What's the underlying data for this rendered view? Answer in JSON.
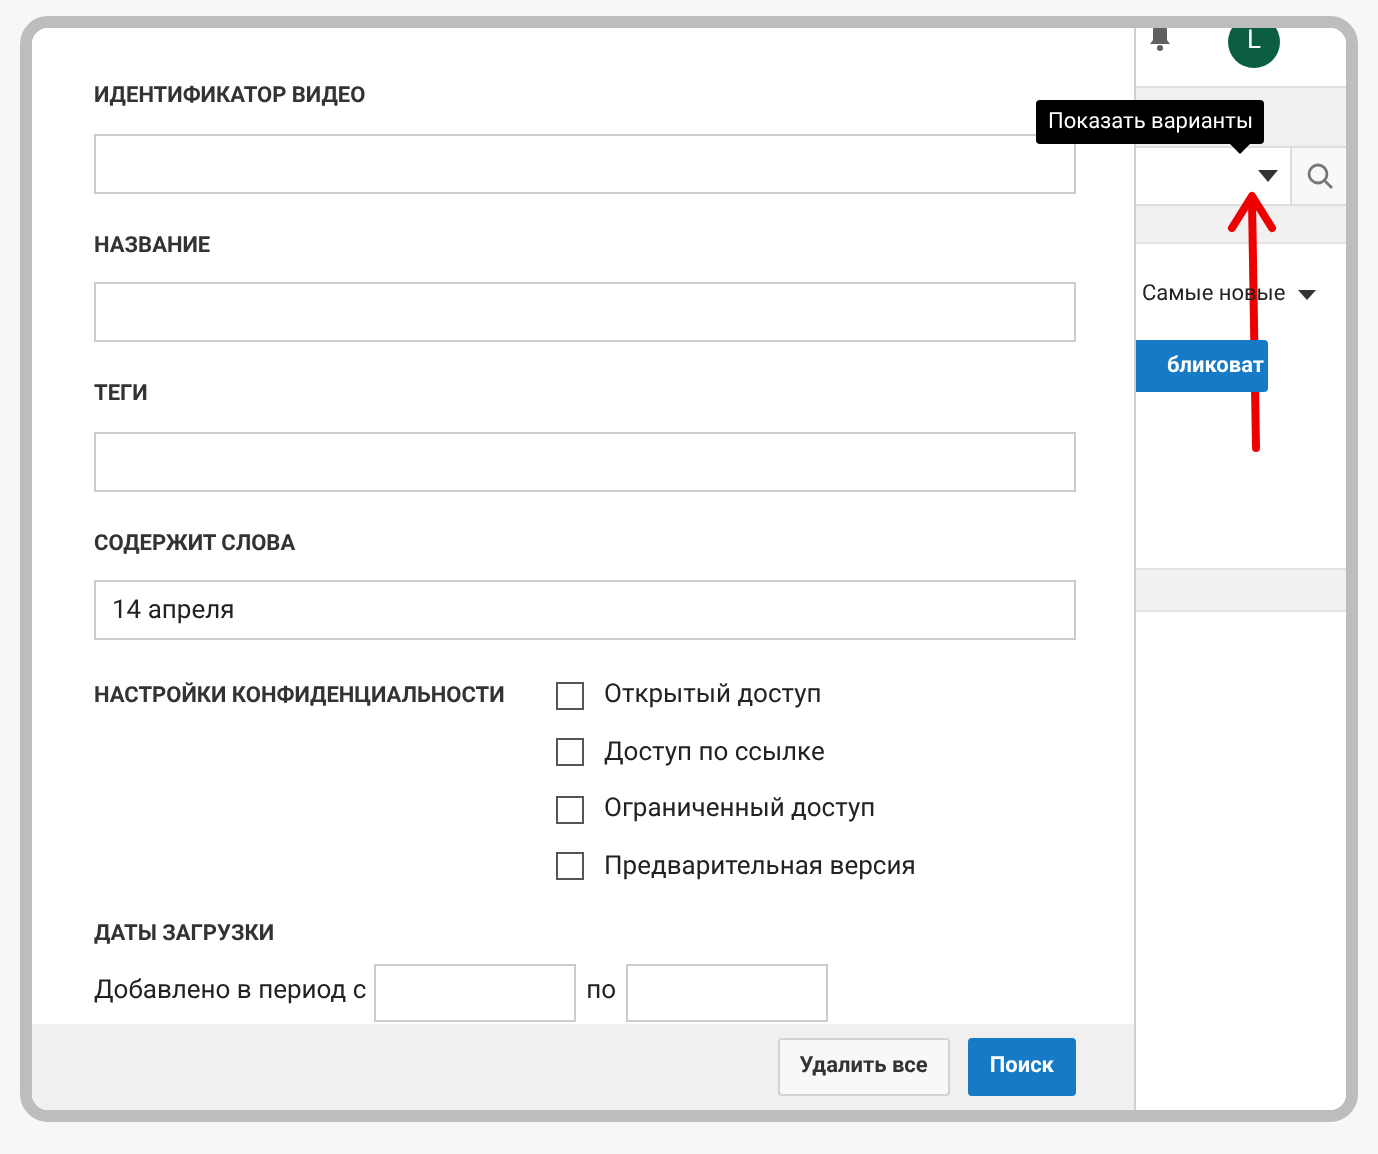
{
  "dialog": {
    "fields": [
      {
        "label": "ИДЕНТИФИКАТОР ВИДЕО"
      },
      {
        "label": "НАЗВАНИЕ"
      },
      {
        "label": "ТЕГИ"
      },
      {
        "label": "СОДЕРЖИТ СЛОВА",
        "value": "14 апреля"
      }
    ],
    "privacy": {
      "label": "НАСТРОЙКИ КОНФИДЕНЦИАЛЬНОСТИ",
      "options": [
        {
          "label": "Открытый доступ",
          "checked": false
        },
        {
          "label": "Доступ по ссылке",
          "checked": false
        },
        {
          "label": "Ограниченный доступ",
          "checked": false
        },
        {
          "label": "Предварительная версия",
          "checked": false
        }
      ]
    },
    "dates": {
      "label": "ДАТЫ ЗАГРУЗКИ",
      "from_label": "Добавлено в период с",
      "to_label": "по"
    },
    "buttons": [
      {
        "label": "Удалить все",
        "kind": "secondary"
      },
      {
        "label": "Поиск",
        "kind": "primary"
      }
    ]
  },
  "background": {
    "avatar": "L",
    "tooltip": "Показать варианты",
    "sort": "Самые новые",
    "button": "бликоват"
  }
}
